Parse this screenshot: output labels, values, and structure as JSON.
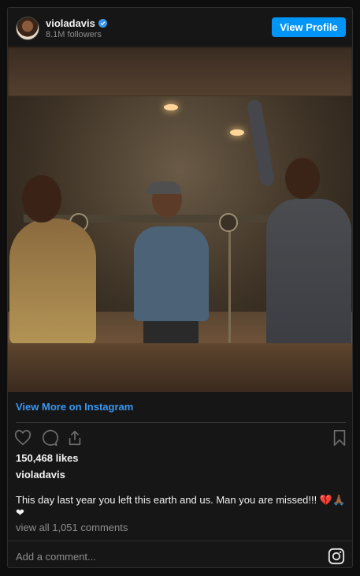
{
  "header": {
    "username": "violadavis",
    "followers": "8.1M followers",
    "view_profile_label": "View Profile"
  },
  "post": {
    "view_more_label": "View More on Instagram",
    "likes": "150,468 likes",
    "owner": "violadavis",
    "caption": "This day last year you left this earth and us. Man you are missed!!! 💔🙏🏾 ❤",
    "view_comments": "view all 1,051 comments",
    "add_comment_placeholder": "Add a comment..."
  },
  "colors": {
    "accent": "#0095f6",
    "link": "#3897f0",
    "background": "#161616",
    "muted_text": "#8e8e8e"
  },
  "icons": [
    "verified-badge-icon",
    "heart-icon",
    "comment-icon",
    "share-icon",
    "bookmark-icon",
    "instagram-logo-icon"
  ]
}
